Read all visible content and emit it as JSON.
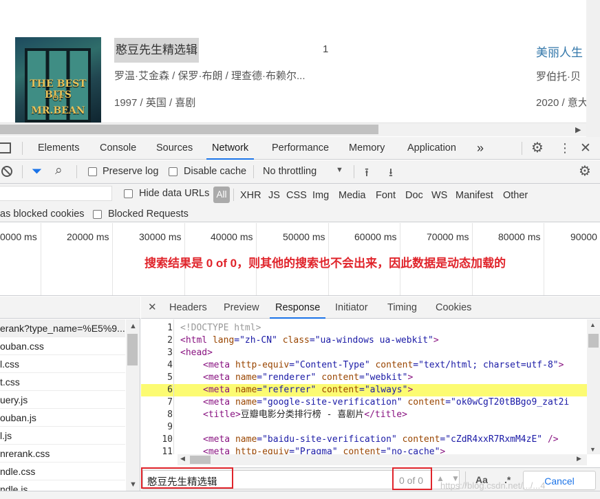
{
  "page": {
    "movie_title": "憨豆先生精选辑",
    "rank": "1",
    "cast": "罗温·艾金森 / 保罗·布朗 / 理查德·布赖尔...",
    "meta": "1997 / 英国 / 喜剧",
    "poster_line1": "THE BEST BITS",
    "poster_line2": "OF",
    "poster_line3": "MR.BEAN",
    "movie2_title": "美丽人生",
    "movie2_cast": "罗伯托·贝",
    "movie2_meta": "2020 / 意大"
  },
  "devtools": {
    "tabs": [
      "Elements",
      "Console",
      "Sources",
      "Network",
      "Performance",
      "Memory",
      "Application"
    ],
    "more": "»",
    "toolbar": {
      "preserve_log": "Preserve log",
      "disable_cache": "Disable cache",
      "throttling": "No throttling"
    },
    "filter": {
      "hide_data_urls": "Hide data URLs",
      "types": [
        "All",
        "XHR",
        "JS",
        "CSS",
        "Img",
        "Media",
        "Font",
        "Doc",
        "WS",
        "Manifest",
        "Other"
      ],
      "blocked_cookies": "as blocked cookies",
      "blocked_requests": "Blocked Requests"
    },
    "timeline_labels": [
      "0000 ms",
      "20000 ms",
      "30000 ms",
      "40000 ms",
      "50000 ms",
      "60000 ms",
      "70000 ms",
      "80000 ms",
      "90000"
    ],
    "annotation": "搜索结果是 0 of 0，则其他的搜索也不会出来，因此数据是动态加载的",
    "files": [
      "erank?type_name=%E5%9...",
      "ouban.css",
      "l.css",
      "t.css",
      "uery.js",
      "ouban.js",
      "l.js",
      "nrerank.css",
      "ndle.css",
      "ndle.js"
    ],
    "detail_tabs": [
      "Headers",
      "Preview",
      "Response",
      "Initiator",
      "Timing",
      "Cookies"
    ],
    "code_lines": [
      {
        "n": "1"
      },
      {
        "n": "2"
      },
      {
        "n": "3"
      },
      {
        "n": "4"
      },
      {
        "n": "5"
      },
      {
        "n": "6"
      },
      {
        "n": "7"
      },
      {
        "n": "8"
      },
      {
        "n": "9"
      },
      {
        "n": "10"
      },
      {
        "n": "11"
      }
    ],
    "code": {
      "l1": "<!DOCTYPE html>",
      "l2a": "<html ",
      "l2b": "lang",
      "l2c": "=\"zh-CN\" ",
      "l2d": "class",
      "l2e": "=\"ua-windows ua-webkit\"",
      "l2f": ">",
      "l3": "<head>",
      "l4a": "<meta ",
      "l4b": "http-equiv",
      "l4c": "=\"Content-Type\" ",
      "l4d": "content",
      "l4e": "=\"text/html; charset=utf-8\"",
      "l4f": ">",
      "l5a": "<meta ",
      "l5b": "name",
      "l5c": "=\"renderer\" ",
      "l5d": "content",
      "l5e": "=\"webkit\"",
      "l5f": ">",
      "l6a": "<meta ",
      "l6b": "name",
      "l6c": "=\"referrer\" ",
      "l6d": "content",
      "l6e": "=\"always\"",
      "l6f": ">",
      "l7a": "<meta ",
      "l7b": "name",
      "l7c": "=\"google-site-verification\" ",
      "l7d": "content",
      "l7e": "=\"ok0wCgT20tBBgo9_zat2i",
      "l8a": "<title>",
      "l8b": "豆瓣电影分类排行榜 - 喜剧片",
      "l8c": "</title>",
      "l10a": "<meta ",
      "l10b": "name",
      "l10c": "=\"baidu-site-verification\" ",
      "l10d": "content",
      "l10e": "=\"cZdR4xxR7RxmM4zE\"",
      "l10f": " />",
      "l11a": "<meta ",
      "l11b": "http-equiv",
      "l11c": "=\"Pragma\" ",
      "l11d": "content",
      "l11e": "=\"no-cache\"",
      "l11f": ">"
    },
    "search": {
      "value": "憨豆先生精选辑",
      "count": "0 of 0",
      "aa": "Aa",
      "regex": ".*",
      "cancel": "Cancel"
    },
    "watermark": "https://blog.csdn.net/.../...4"
  },
  "colors": {
    "accent": "#1a73e8",
    "annotation": "#e0242b",
    "highlight": "#fcfb72"
  }
}
